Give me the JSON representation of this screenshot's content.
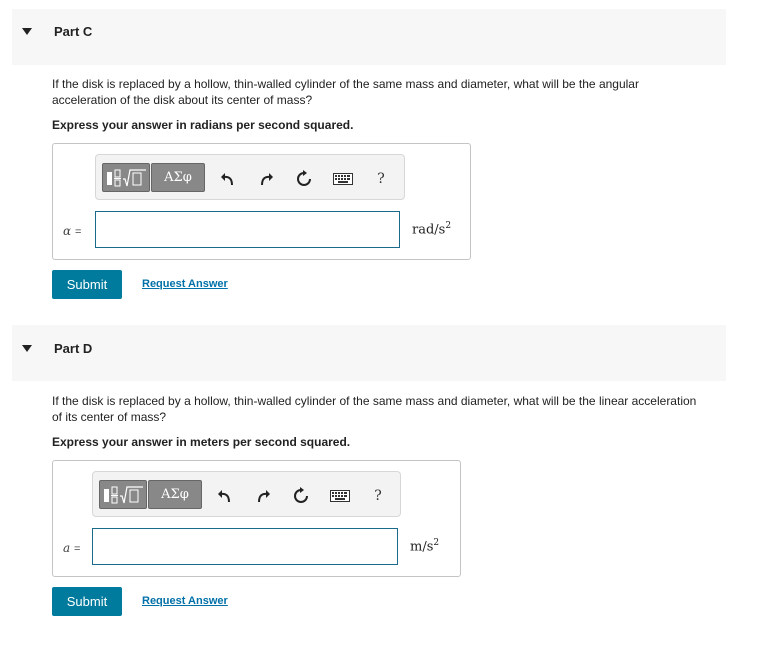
{
  "part_c": {
    "title": "Part C",
    "question": "If the disk is replaced by a hollow, thin-walled cylinder of the same mass and diameter, what will be the angular acceleration of the disk about its center of mass?",
    "instruction": "Express your answer in radians per second squared.",
    "variable": "α",
    "equals": "=",
    "input_value": "",
    "unit_base": "rad/s",
    "unit_exp": "2",
    "submit_label": "Submit",
    "request_label": "Request Answer"
  },
  "part_d": {
    "title": "Part D",
    "question": "If the disk is replaced by a hollow, thin-walled cylinder of the same mass and diameter, what will be the linear acceleration of its center of mass?",
    "instruction": "Express your answer in meters per second squared.",
    "variable": "a",
    "equals": "=",
    "input_value": "",
    "unit_base": "m/s",
    "unit_exp": "2",
    "submit_label": "Submit",
    "request_label": "Request Answer"
  },
  "toolbar": {
    "greek_label": "ΑΣφ",
    "help_label": "?",
    "icons": [
      "templates-icon",
      "greek-icon",
      "undo-icon",
      "redo-icon",
      "reset-icon",
      "keyboard-icon",
      "help-icon"
    ]
  }
}
